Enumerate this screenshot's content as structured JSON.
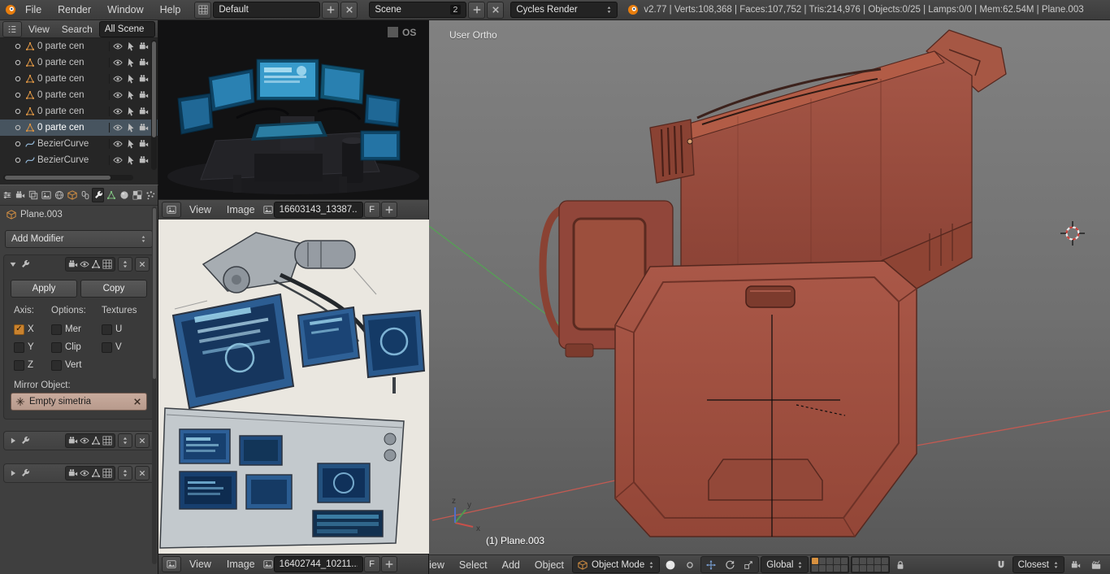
{
  "glyphs": {
    "check": "✓"
  },
  "colors": {
    "accent_orange": "#d8913f",
    "clay": "#a05140",
    "axis_x_red": "#cc5555",
    "axis_y_green": "#55a055",
    "screen_blue": "#3f9fd8"
  },
  "top_bar": {
    "menus": [
      {
        "label": "File"
      },
      {
        "label": "Render"
      },
      {
        "label": "Window"
      },
      {
        "label": "Help"
      }
    ],
    "layout": {
      "value": "Default"
    },
    "scene": {
      "value": "Scene",
      "users": "2"
    },
    "engine": {
      "value": "Cycles Render"
    },
    "stats": "v2.77 | Verts:108,368 | Faces:107,752 | Tris:214,976 | Objects:0/25 | Lamps:0/0 | Mem:62.54M | Plane.003"
  },
  "outliner": {
    "menus": [
      {
        "label": "View"
      },
      {
        "label": "Search"
      }
    ],
    "filter": {
      "value": "All Scene"
    },
    "items": [
      {
        "label": "0 parte cen",
        "type": "mesh",
        "active": false
      },
      {
        "label": "0 parte cen",
        "type": "mesh",
        "active": false
      },
      {
        "label": "0 parte cen",
        "type": "mesh",
        "active": false
      },
      {
        "label": "0 parte cen",
        "type": "mesh",
        "active": false
      },
      {
        "label": "0 parte cen",
        "type": "mesh",
        "active": false
      },
      {
        "label": "0 parte cen",
        "type": "mesh",
        "active": true
      },
      {
        "label": "BezierCurve",
        "type": "curve",
        "active": false
      },
      {
        "label": "BezierCurve",
        "type": "curve",
        "active": false
      }
    ]
  },
  "properties": {
    "breadcrumb": {
      "object": "Plane.003"
    },
    "add_modifier_label": "Add Modifier",
    "mirror": {
      "apply_label": "Apply",
      "copy_label": "Copy",
      "axis_label": "Axis:",
      "options_label": "Options:",
      "textures_label": "Textures",
      "checkboxes": [
        {
          "label": "X",
          "checked": true
        },
        {
          "label": "Mer",
          "checked": false
        },
        {
          "label": "U",
          "checked": false
        },
        {
          "label": "Y",
          "checked": false
        },
        {
          "label": "Clip",
          "checked": false
        },
        {
          "label": "V",
          "checked": false
        },
        {
          "label": "Z",
          "checked": false
        },
        {
          "label": "Vert",
          "checked": false
        }
      ],
      "mirror_object_label": "Mirror Object:",
      "mirror_object_value": "Empty simetria"
    }
  },
  "image_editor_top": {
    "menus": [
      {
        "label": "View"
      },
      {
        "label": "Image"
      }
    ],
    "image_name": "16603143_13387...",
    "fake_user_label": "F",
    "watermark": "OS"
  },
  "image_editor_bottom": {
    "menus": [
      {
        "label": "View"
      },
      {
        "label": "Image"
      }
    ],
    "image_name": "16402744_10211...",
    "fake_user_label": "F"
  },
  "viewport": {
    "view_label": "User Ortho",
    "active_object_label": "(1) Plane.003",
    "menus": [
      {
        "label": "View"
      },
      {
        "label": "Select"
      },
      {
        "label": "Add"
      },
      {
        "label": "Object"
      }
    ],
    "mode": "Object Mode",
    "orientation": "Global",
    "snap_element": "Closest",
    "axis_labels": {
      "x": "x",
      "y": "y",
      "z": "z"
    }
  }
}
